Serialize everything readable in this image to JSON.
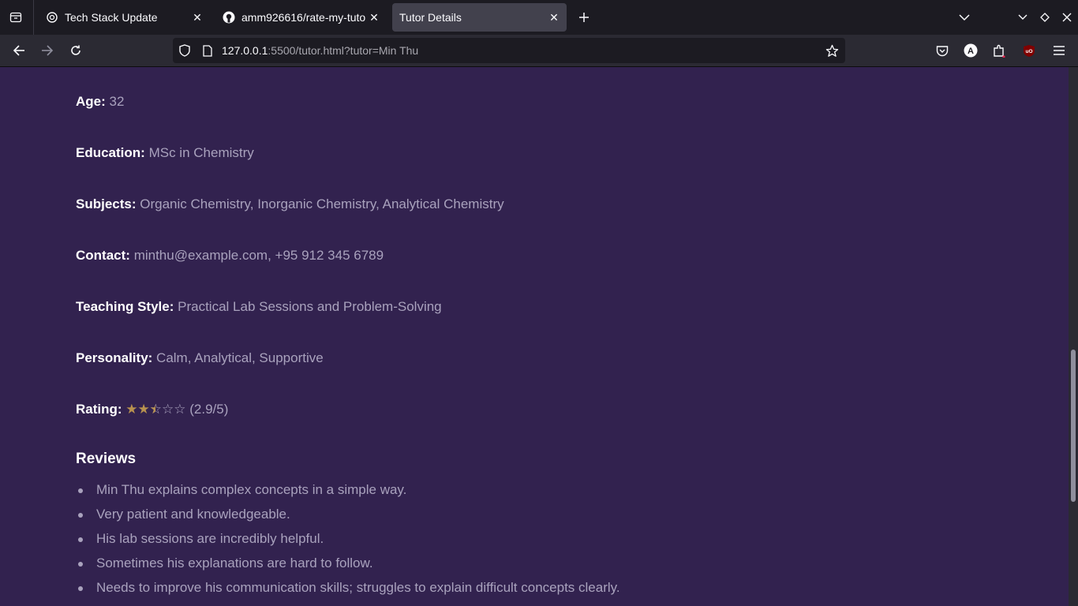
{
  "tabs": [
    {
      "title": "Tech Stack Update",
      "icon": "openai-icon"
    },
    {
      "title": "amm926616/rate-my-tutor",
      "icon": "github-icon"
    },
    {
      "title": "Tutor Details",
      "icon": "none"
    }
  ],
  "address_bar": {
    "host": "127.0.0.1",
    "rest": ":5500/tutor.html?tutor=Min Thu"
  },
  "extensions": {
    "account_letter": "A",
    "ublock_label": "uO"
  },
  "tutor": {
    "age_label": "Age:",
    "age": "32",
    "education_label": "Education:",
    "education": "MSc in Chemistry",
    "subjects_label": "Subjects:",
    "subjects": "Organic Chemistry, Inorganic Chemistry, Analytical Chemistry",
    "contact_label": "Contact:",
    "contact": "minthu@example.com, +95 912 345 6789",
    "teaching_style_label": "Teaching Style:",
    "teaching_style": "Practical Lab Sessions and Problem-Solving",
    "personality_label": "Personality:",
    "personality": "Calm, Analytical, Supportive",
    "rating_label": "Rating:",
    "rating_value": 2.9,
    "rating_max": 5,
    "rating_text": "(2.9/5)"
  },
  "reviews_heading": "Reviews",
  "reviews": [
    "Min Thu explains complex concepts in a simple way.",
    "Very patient and knowledgeable.",
    "His lab sessions are incredibly helpful.",
    "Sometimes his explanations are hard to follow.",
    "Needs to improve his communication skills; struggles to explain difficult concepts clearly."
  ],
  "colors": {
    "page_bg": "#32224f",
    "star_fill": "#b8924f",
    "value_text": "#a9a2bd"
  }
}
